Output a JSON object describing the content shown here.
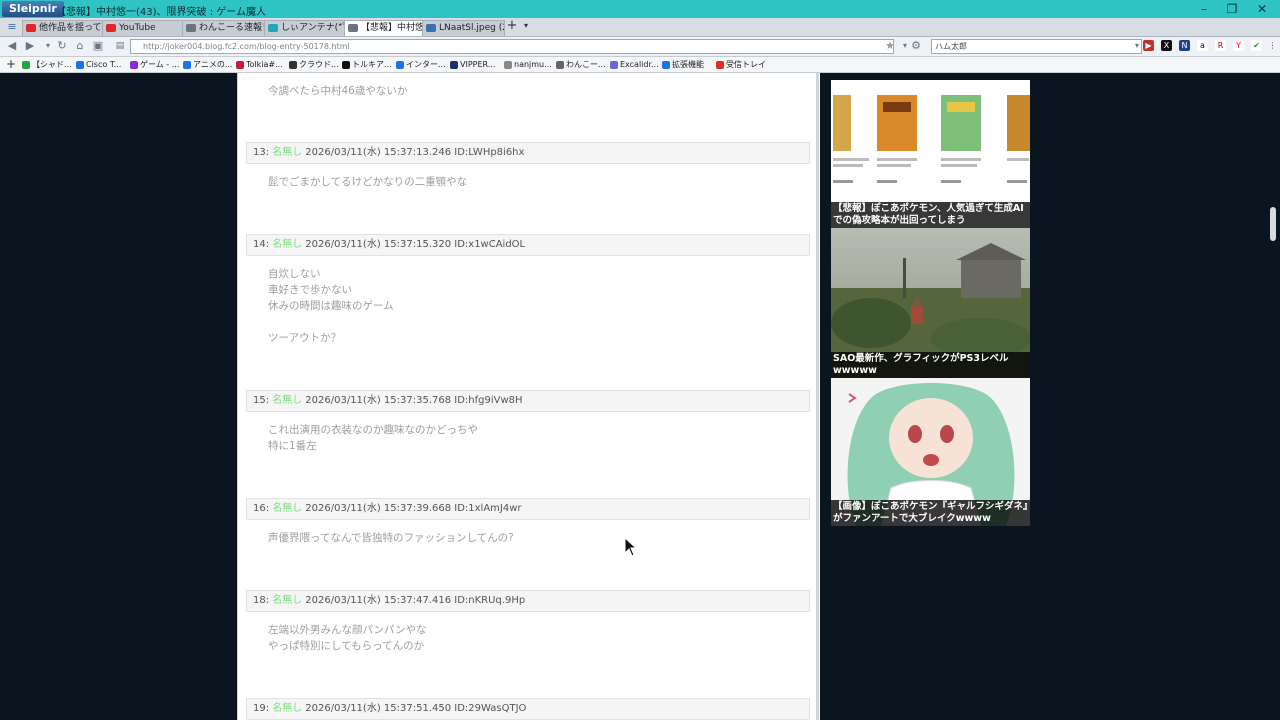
{
  "app": {
    "brand": "Sleipnir",
    "window_title": "【悲報】中村悠一(43)、限界突破 : ゲーム魔人"
  },
  "tabs": [
    {
      "label": "他作品を揺って...",
      "color": "#e0262a"
    },
    {
      "label": "YouTube",
      "color": "#e0262a"
    },
    {
      "label": "わんこーる速報！",
      "color": "#6b7280"
    },
    {
      "label": "しぃアンテナ(*ﾟーﾟ)",
      "color": "#25a6b3"
    },
    {
      "label": "【悲報】中村悠一...",
      "color": "#6b7280"
    },
    {
      "label": "LNaatSl.jpeg (2...",
      "color": "#3a6fb0"
    }
  ],
  "address": {
    "url": "http://joker004.blog.fc2.com/blog-entry-50178.html",
    "search_value": "ハム太郎"
  },
  "bookmarks": [
    {
      "label": "【シャド...",
      "color": "#25a641"
    },
    {
      "label": "Cisco T...",
      "color": "#1a73e8"
    },
    {
      "label": "ゲーム - ...",
      "color": "#8a2be2"
    },
    {
      "label": "アニメの...",
      "color": "#1a73e8"
    },
    {
      "label": "Tolkia#...",
      "color": "#c41e3a"
    },
    {
      "label": "クラウド...",
      "color": "#333333"
    },
    {
      "label": "トルキア...",
      "color": "#111111"
    },
    {
      "label": "インター...",
      "color": "#1a73e8"
    },
    {
      "label": "VIPPER...",
      "color": "#1e2f6e"
    },
    {
      "label": "nanjmu...",
      "color": "#888888"
    },
    {
      "label": "わんこー...",
      "color": "#666666"
    },
    {
      "label": "Excalidr...",
      "color": "#6965db"
    },
    {
      "label": "拡張機能",
      "color": "#1a73e8"
    },
    {
      "label": "受信トレイ",
      "color": "#d93025"
    }
  ],
  "first_post_tail": "今調べたら中村46歳やないか",
  "posts": [
    {
      "num": "13:",
      "name": "名無し",
      "meta": "2026/03/11(水) 15:37:13.246 ID:LWHp8i6hx",
      "lines": [
        "髭でごまかしてるけどかなりの二重顎やな"
      ]
    },
    {
      "num": "14:",
      "name": "名無し",
      "meta": "2026/03/11(水) 15:37:15.320 ID:x1wCAidOL",
      "lines": [
        "自炊しない",
        "車好きで歩かない",
        "休みの時間は趣味のゲーム",
        "",
        "ツーアウトか？"
      ]
    },
    {
      "num": "15:",
      "name": "名無し",
      "meta": "2026/03/11(水) 15:37:35.768 ID:hfg9iVw8H",
      "lines": [
        "これ出演用の衣装なのか趣味なのかどっちや",
        "特に1番左"
      ]
    },
    {
      "num": "16:",
      "name": "名無し",
      "meta": "2026/03/11(水) 15:37:39.668 ID:1xlAmJ4wr",
      "lines": [
        "声優界隈ってなんで皆独特のファッションしてんの?"
      ]
    },
    {
      "num": "18:",
      "name": "名無し",
      "meta": "2026/03/11(水) 15:37:47.416 ID:nKRUq.9Hp",
      "lines": [
        "左端以外男みんな顔パンパンやな",
        "やっぱ特別にしてもらってんのか"
      ]
    },
    {
      "num": "19:",
      "name": "名無し",
      "meta": "2026/03/11(水) 15:37:51.450 ID:29WasQTJO",
      "lines": []
    }
  ],
  "sidebar": [
    {
      "caption": "【悲報】ぽこあポケモン、人気過ぎて生成AIでの偽攻略本が出回ってしまう"
    },
    {
      "caption": "SAO最新作、グラフィックがPS3レベルwwwww"
    },
    {
      "caption": "【画像】ぽこあポケモン『ギャルフシギダネ』がファンアートで大ブレイクwwww"
    }
  ],
  "colors": {
    "titlebar": "#2ec4c4",
    "page_bg": "#0b1520",
    "name_green": "#7ddd7d",
    "body_text": "#9e9e9e"
  }
}
